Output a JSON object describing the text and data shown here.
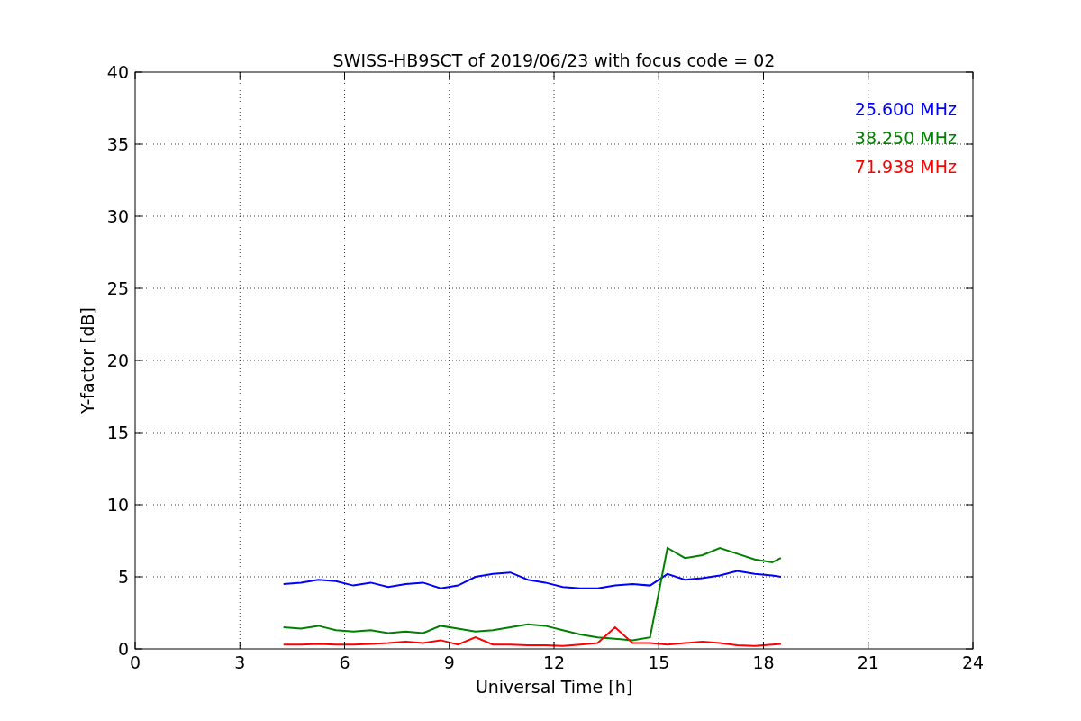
{
  "chart_data": {
    "type": "line",
    "title": "SWISS-HB9SCT of 2019/06/23 with focus code = 02",
    "xlabel": "Universal Time [h]",
    "ylabel": "Y-factor [dB]",
    "x": [
      4.25,
      4.75,
      5.25,
      5.75,
      6.25,
      6.75,
      7.25,
      7.75,
      8.25,
      8.75,
      9.25,
      9.75,
      10.25,
      10.75,
      11.25,
      11.75,
      12.25,
      12.75,
      13.25,
      13.75,
      14.25,
      14.75,
      15.25,
      15.75,
      16.25,
      16.75,
      17.25,
      17.75,
      18.25,
      18.5
    ],
    "series": [
      {
        "name": "25.600 MHz",
        "color": "#0000ff",
        "values": [
          4.5,
          4.6,
          4.8,
          4.7,
          4.4,
          4.6,
          4.3,
          4.5,
          4.6,
          4.2,
          4.4,
          5.0,
          5.2,
          5.3,
          4.8,
          4.6,
          4.3,
          4.2,
          4.2,
          4.4,
          4.5,
          4.4,
          5.2,
          4.8,
          4.9,
          5.1,
          5.4,
          5.2,
          5.1,
          5.0
        ]
      },
      {
        "name": "38.250 MHz",
        "color": "#008000",
        "values": [
          1.5,
          1.4,
          1.6,
          1.3,
          1.2,
          1.3,
          1.1,
          1.2,
          1.1,
          1.6,
          1.4,
          1.2,
          1.3,
          1.5,
          1.7,
          1.6,
          1.3,
          1.0,
          0.8,
          0.7,
          0.6,
          0.8,
          7.0,
          6.3,
          6.5,
          7.0,
          6.6,
          6.2,
          6.0,
          6.3
        ]
      },
      {
        "name": "71.938 MHz",
        "color": "#ff0000",
        "values": [
          0.3,
          0.3,
          0.35,
          0.3,
          0.3,
          0.35,
          0.4,
          0.5,
          0.4,
          0.6,
          0.3,
          0.8,
          0.3,
          0.3,
          0.25,
          0.25,
          0.2,
          0.3,
          0.4,
          1.5,
          0.4,
          0.4,
          0.3,
          0.4,
          0.5,
          0.4,
          0.25,
          0.2,
          0.3,
          0.35
        ]
      }
    ],
    "grid": true,
    "xlim": [
      0,
      24
    ],
    "ylim": [
      0,
      40
    ],
    "xticks": [
      0,
      3,
      6,
      9,
      12,
      15,
      18,
      21,
      24
    ],
    "yticks": [
      0,
      5,
      10,
      15,
      20,
      25,
      30,
      35,
      40
    ]
  }
}
